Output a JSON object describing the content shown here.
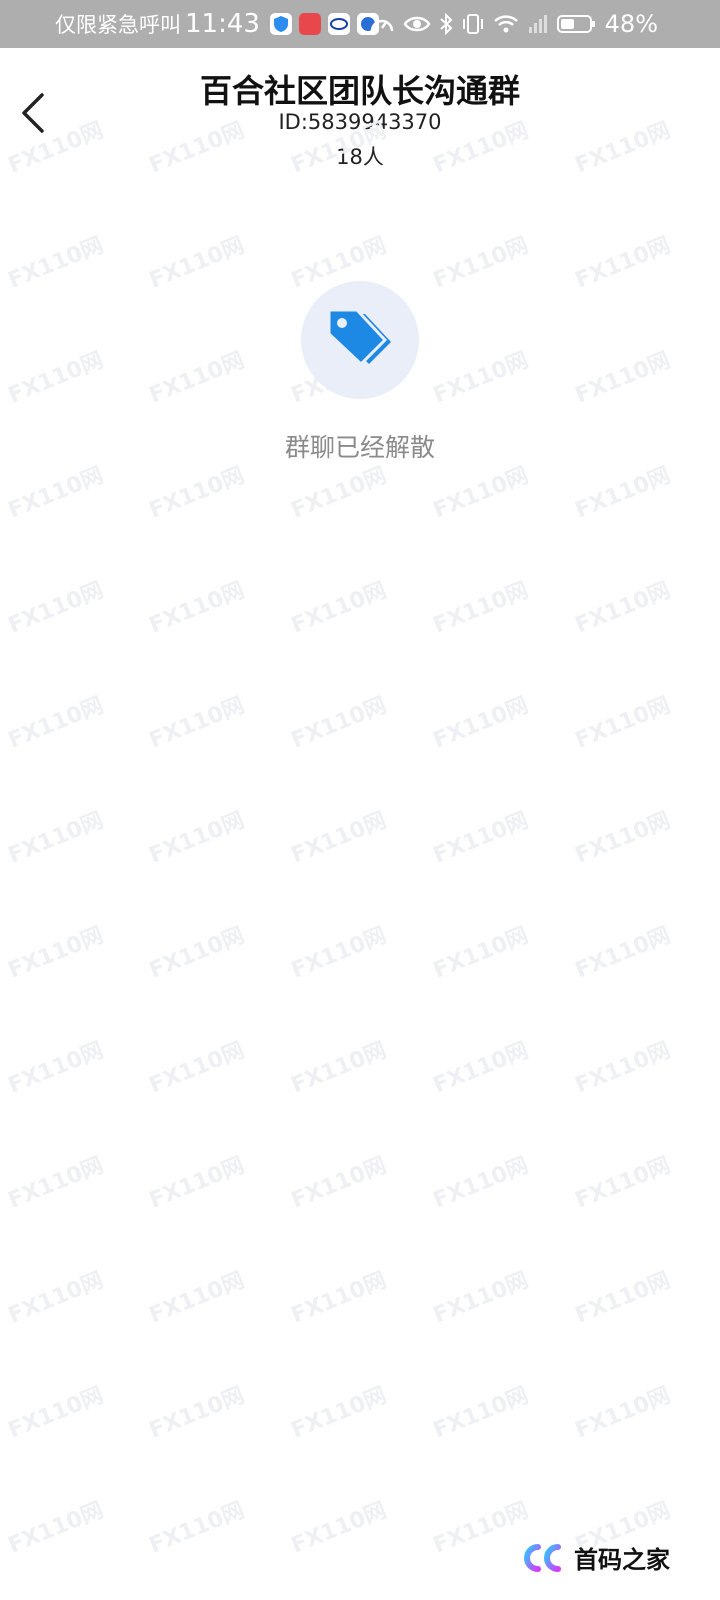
{
  "status_bar": {
    "carrier": "仅限紧急呼叫",
    "time": "11:43",
    "battery_percent": "48%",
    "battery_level": 0.48
  },
  "header": {
    "title": "百合社区团队长沟通群",
    "group_id": "ID:5839943370",
    "member_count": "18人"
  },
  "empty_state": {
    "icon": "tag-icon",
    "message": "群聊已经解散",
    "accent_color": "#1e88e5"
  },
  "watermark": {
    "text": "FX110网"
  },
  "brand": {
    "name": "首码之家"
  }
}
